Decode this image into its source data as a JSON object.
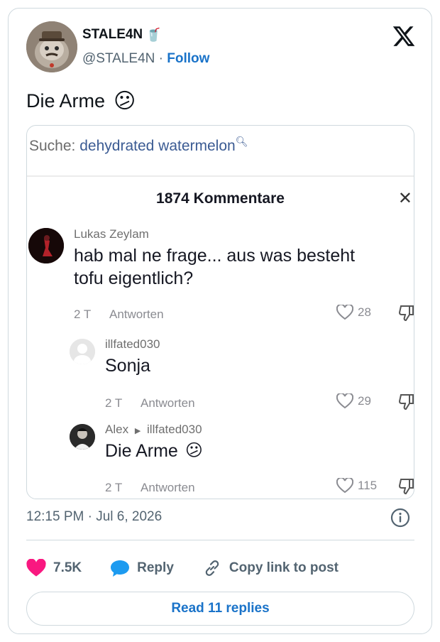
{
  "author": {
    "display_name": "STALE4N",
    "badge_emoji": "🥤",
    "handle": "@STALE4N",
    "separator": "·",
    "follow_label": "Follow"
  },
  "tweet": {
    "text": "Die Arme",
    "emoji": "😕"
  },
  "embed": {
    "search_prefix": "Suche:",
    "search_query": "dehydrated watermelon",
    "comments_count": "1874 Kommentare",
    "comments": [
      {
        "user": "Lukas Zeylam",
        "text_line1": "hab mal ne frage... aus was besteht",
        "text_line2": "tofu eigentlich?",
        "time": "2 T",
        "reply_label": "Antworten",
        "likes": "28"
      },
      {
        "user": "illfated030",
        "text_line1": "Sonja",
        "time": "2 T",
        "reply_label": "Antworten",
        "likes": "29"
      },
      {
        "user": "Alex",
        "reply_to": "illfated030",
        "text_line1": "Die Arme",
        "emoji": "😕",
        "time": "2 T",
        "reply_label": "Antworten",
        "likes": "115"
      }
    ]
  },
  "meta": {
    "timestamp": "12:15 PM · Jul 6, 2026"
  },
  "actions": {
    "like_count": "7.5K",
    "reply_label": "Reply",
    "copy_link_label": "Copy link to post"
  },
  "read_replies_label": "Read 11 replies",
  "colors": {
    "accent_blue": "#1a73c9",
    "heart": "#f91880",
    "reply_bubble": "#1d9bf0",
    "muted": "#536471"
  }
}
